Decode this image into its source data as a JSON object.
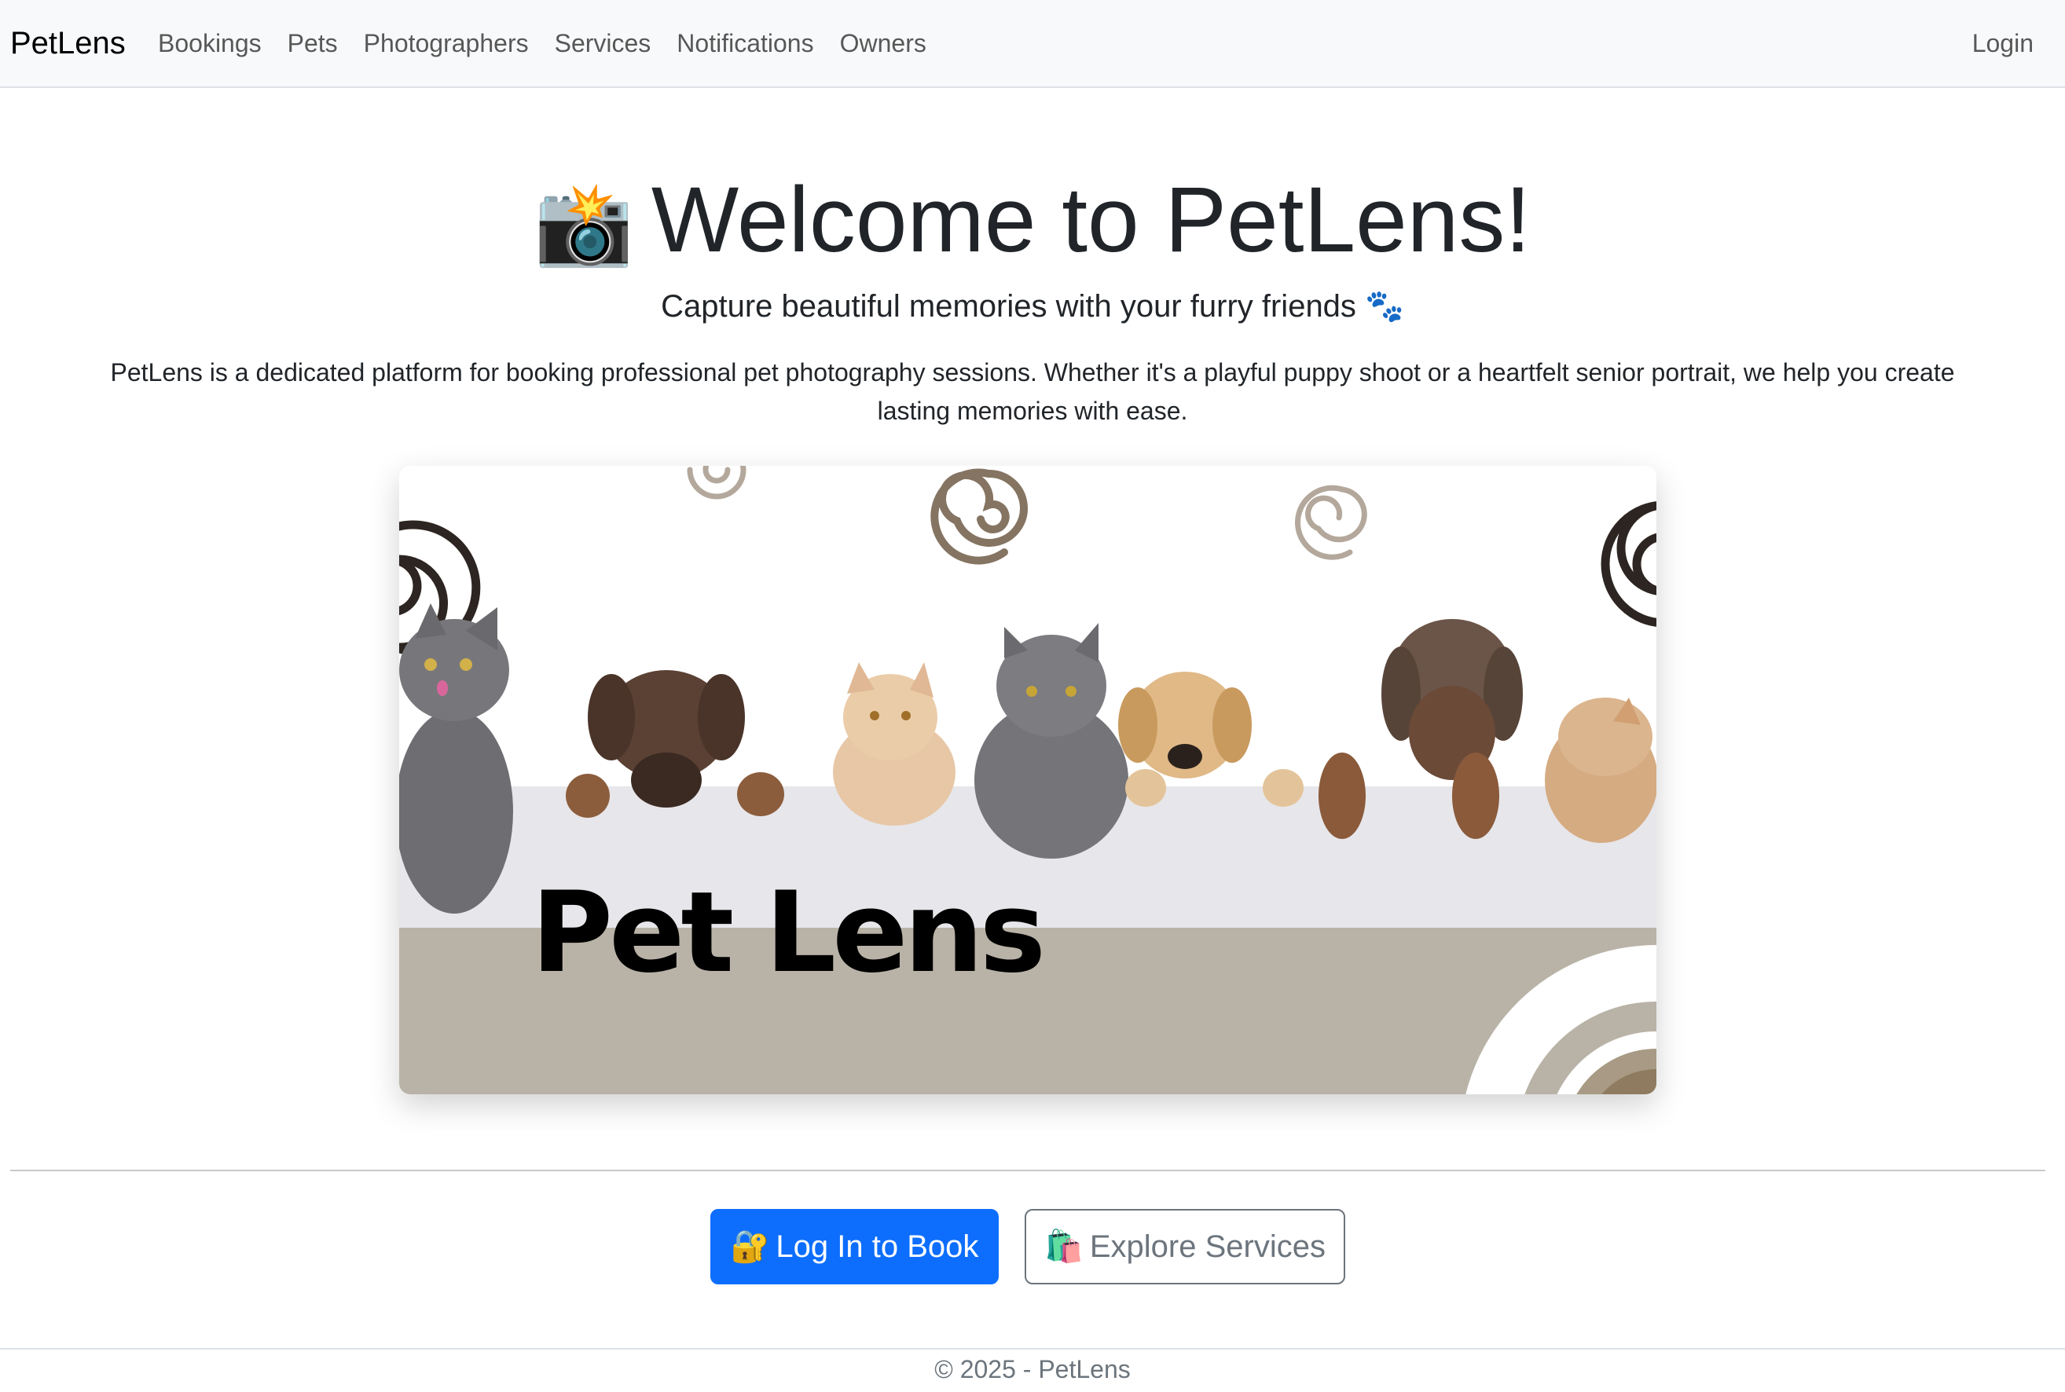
{
  "navbar": {
    "brand": "PetLens",
    "links": [
      "Bookings",
      "Pets",
      "Photographers",
      "Services",
      "Notifications",
      "Owners"
    ],
    "login": "Login"
  },
  "hero": {
    "emoji": "📸",
    "title": "Welcome to PetLens!",
    "subtitle": "Capture beautiful memories with your furry friends",
    "subtitle_emoji": "🐾",
    "description": "PetLens is a dedicated platform for booking professional pet photography sessions. Whether it's a playful puppy shoot or a heartfelt senior portrait, we help you create lasting memories with ease."
  },
  "banner": {
    "title": "Pet Lens"
  },
  "actions": {
    "login_icon": "🔐",
    "login_label": "Log In to Book",
    "explore_icon": "🛍️",
    "explore_label": "Explore Services"
  },
  "footer": {
    "text": "© 2025 - PetLens"
  },
  "colors": {
    "primary": "#0d6efd",
    "secondary": "#6c757d",
    "navbar_bg": "#f8f9fa",
    "banner_band": "#b9b3a7",
    "banner_accent": "#8e7b60"
  }
}
